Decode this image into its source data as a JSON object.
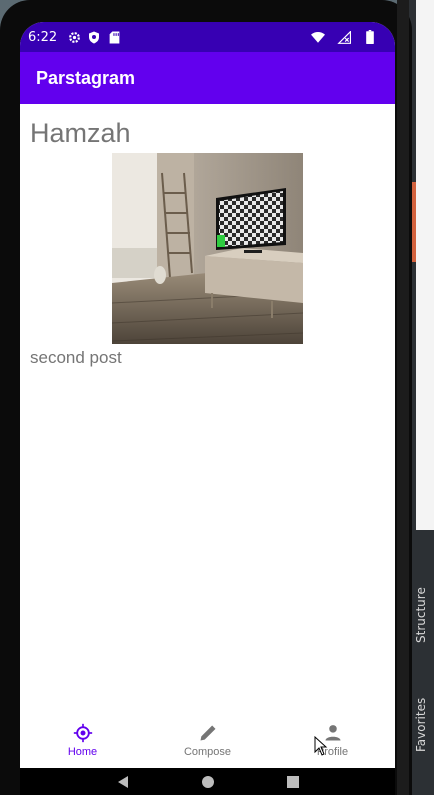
{
  "status_bar": {
    "time": "6:22",
    "icons": [
      "gear-icon",
      "shield-icon",
      "sd-card-icon",
      "wifi-icon",
      "no-signal-icon",
      "battery-icon"
    ]
  },
  "app_bar": {
    "title": "Parstagram"
  },
  "post": {
    "username": "Hamzah",
    "caption": "second post",
    "image": "photo of a living room with a TV on a stand"
  },
  "bottom_nav": {
    "items": [
      {
        "label": "Home",
        "icon": "home-compass-icon",
        "active": true
      },
      {
        "label": "Compose",
        "icon": "pencil-icon",
        "active": false
      },
      {
        "label": "Profile",
        "icon": "person-icon",
        "active": false
      }
    ]
  },
  "desktop": {
    "structure_tab": "Structure",
    "favorites_tab": "Favorites"
  },
  "colors": {
    "status_bar": "#3700b3",
    "app_bar": "#6200ee",
    "accent": "#6200ee",
    "text_secondary": "#757575"
  }
}
